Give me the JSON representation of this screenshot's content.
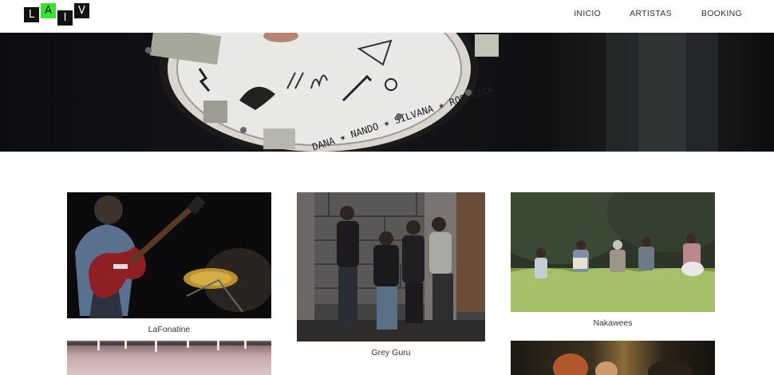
{
  "logo": {
    "letters": [
      "L",
      "A",
      "I",
      "V"
    ],
    "accent_color": "#35e62f"
  },
  "nav": {
    "items": [
      "INICIO",
      "ARTISTAS",
      "BOOKING"
    ]
  },
  "hero": {
    "drum_names": "DANA ✶ NANDO ✶ SILVANA ✶ RODERICK"
  },
  "artists": [
    {
      "name": "LaFonatine"
    },
    {
      "name": "Grey Guru"
    },
    {
      "name": "Nakawees"
    }
  ]
}
